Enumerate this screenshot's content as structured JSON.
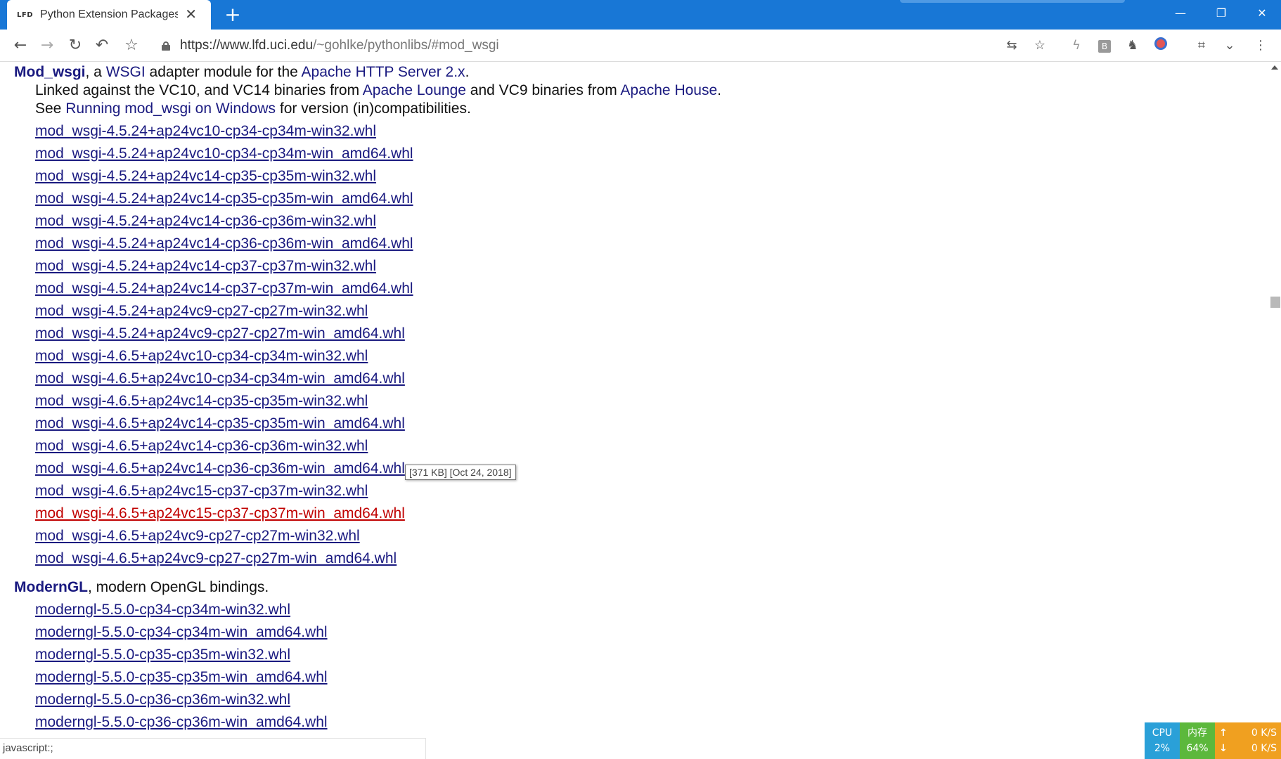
{
  "browser": {
    "tab": {
      "favicon": "LFD",
      "title": "Python Extension Packages"
    },
    "url_main": "https://www.lfd.uci.edu",
    "url_path": "/~gohlke/pythonlibs/#mod_wsgi",
    "icons": {
      "back": "back-arrow-icon",
      "forward": "forward-arrow-icon",
      "reload": "reload-icon",
      "undo": "undo-icon",
      "bookmark": "star-icon",
      "lock": "lock-icon",
      "translate": "translate-icon",
      "bookmark_page": "star-icon",
      "flash": "lightning-icon",
      "extension_b": "b-extension-icon",
      "extension_ninja": "ninja-icon",
      "extension_face": "face-icon",
      "crop": "crop-icon",
      "more_ext": "double-chevron-down-icon",
      "menu": "kebab-menu-icon"
    },
    "colors": {
      "titlebar": "#1877d6",
      "link": "#1a1a80",
      "link_hover": "#c00000"
    }
  },
  "page": {
    "mod_wsgi": {
      "name": "Mod_wsgi",
      "intro_a": ", a ",
      "wsgi_link": "WSGI",
      "intro_b": " adapter module for the ",
      "apache_link": "Apache HTTP Server 2.x",
      "intro_c": ".",
      "line2_a": "Linked against the VC10, and VC14 binaries from ",
      "lounge_link": "Apache Lounge",
      "line2_b": " and VC9 binaries from ",
      "house_link": "Apache House",
      "line2_c": ".",
      "line3_a": "See ",
      "running_link": "Running mod_wsgi on Windows",
      "line3_b": " for version (in)compatibilities.",
      "files": [
        "mod_wsgi-4.5.24+ap24vc10-cp34-cp34m-win32.whl",
        "mod_wsgi-4.5.24+ap24vc10-cp34-cp34m-win_amd64.whl",
        "mod_wsgi-4.5.24+ap24vc14-cp35-cp35m-win32.whl",
        "mod_wsgi-4.5.24+ap24vc14-cp35-cp35m-win_amd64.whl",
        "mod_wsgi-4.5.24+ap24vc14-cp36-cp36m-win32.whl",
        "mod_wsgi-4.5.24+ap24vc14-cp36-cp36m-win_amd64.whl",
        "mod_wsgi-4.5.24+ap24vc14-cp37-cp37m-win32.whl",
        "mod_wsgi-4.5.24+ap24vc14-cp37-cp37m-win_amd64.whl",
        "mod_wsgi-4.5.24+ap24vc9-cp27-cp27m-win32.whl",
        "mod_wsgi-4.5.24+ap24vc9-cp27-cp27m-win_amd64.whl",
        "mod_wsgi-4.6.5+ap24vc10-cp34-cp34m-win32.whl",
        "mod_wsgi-4.6.5+ap24vc10-cp34-cp34m-win_amd64.whl",
        "mod_wsgi-4.6.5+ap24vc14-cp35-cp35m-win32.whl",
        "mod_wsgi-4.6.5+ap24vc14-cp35-cp35m-win_amd64.whl",
        "mod_wsgi-4.6.5+ap24vc14-cp36-cp36m-win32.whl",
        "mod_wsgi-4.6.5+ap24vc14-cp36-cp36m-win_amd64.whl",
        "mod_wsgi-4.6.5+ap24vc15-cp37-cp37m-win32.whl",
        "mod_wsgi-4.6.5+ap24vc15-cp37-cp37m-win_amd64.whl",
        "mod_wsgi-4.6.5+ap24vc9-cp27-cp27m-win32.whl",
        "mod_wsgi-4.6.5+ap24vc9-cp27-cp27m-win_amd64.whl"
      ],
      "hovered_file": "mod_wsgi-4.6.5+ap24vc15-cp37-cp37m-win_amd64.whl"
    },
    "moderngl": {
      "name": "ModernGL",
      "desc": ", modern OpenGL bindings.",
      "files": [
        "moderngl-5.5.0-cp34-cp34m-win32.whl",
        "moderngl-5.5.0-cp34-cp34m-win_amd64.whl",
        "moderngl-5.5.0-cp35-cp35m-win32.whl",
        "moderngl-5.5.0-cp35-cp35m-win_amd64.whl",
        "moderngl-5.5.0-cp36-cp36m-win32.whl",
        "moderngl-5.5.0-cp36-cp36m-win_amd64.whl"
      ]
    },
    "tooltip": "[371 KB] [Oct 24, 2018]"
  },
  "status_text": "javascript:;",
  "monitor": {
    "cpu_label": "CPU",
    "cpu_value": "2%",
    "mem_label": "内存",
    "mem_value": "64%",
    "up_arrow": "↑",
    "down_arrow": "↓",
    "up_speed": "0 K/S",
    "down_speed": "0 K/S"
  }
}
